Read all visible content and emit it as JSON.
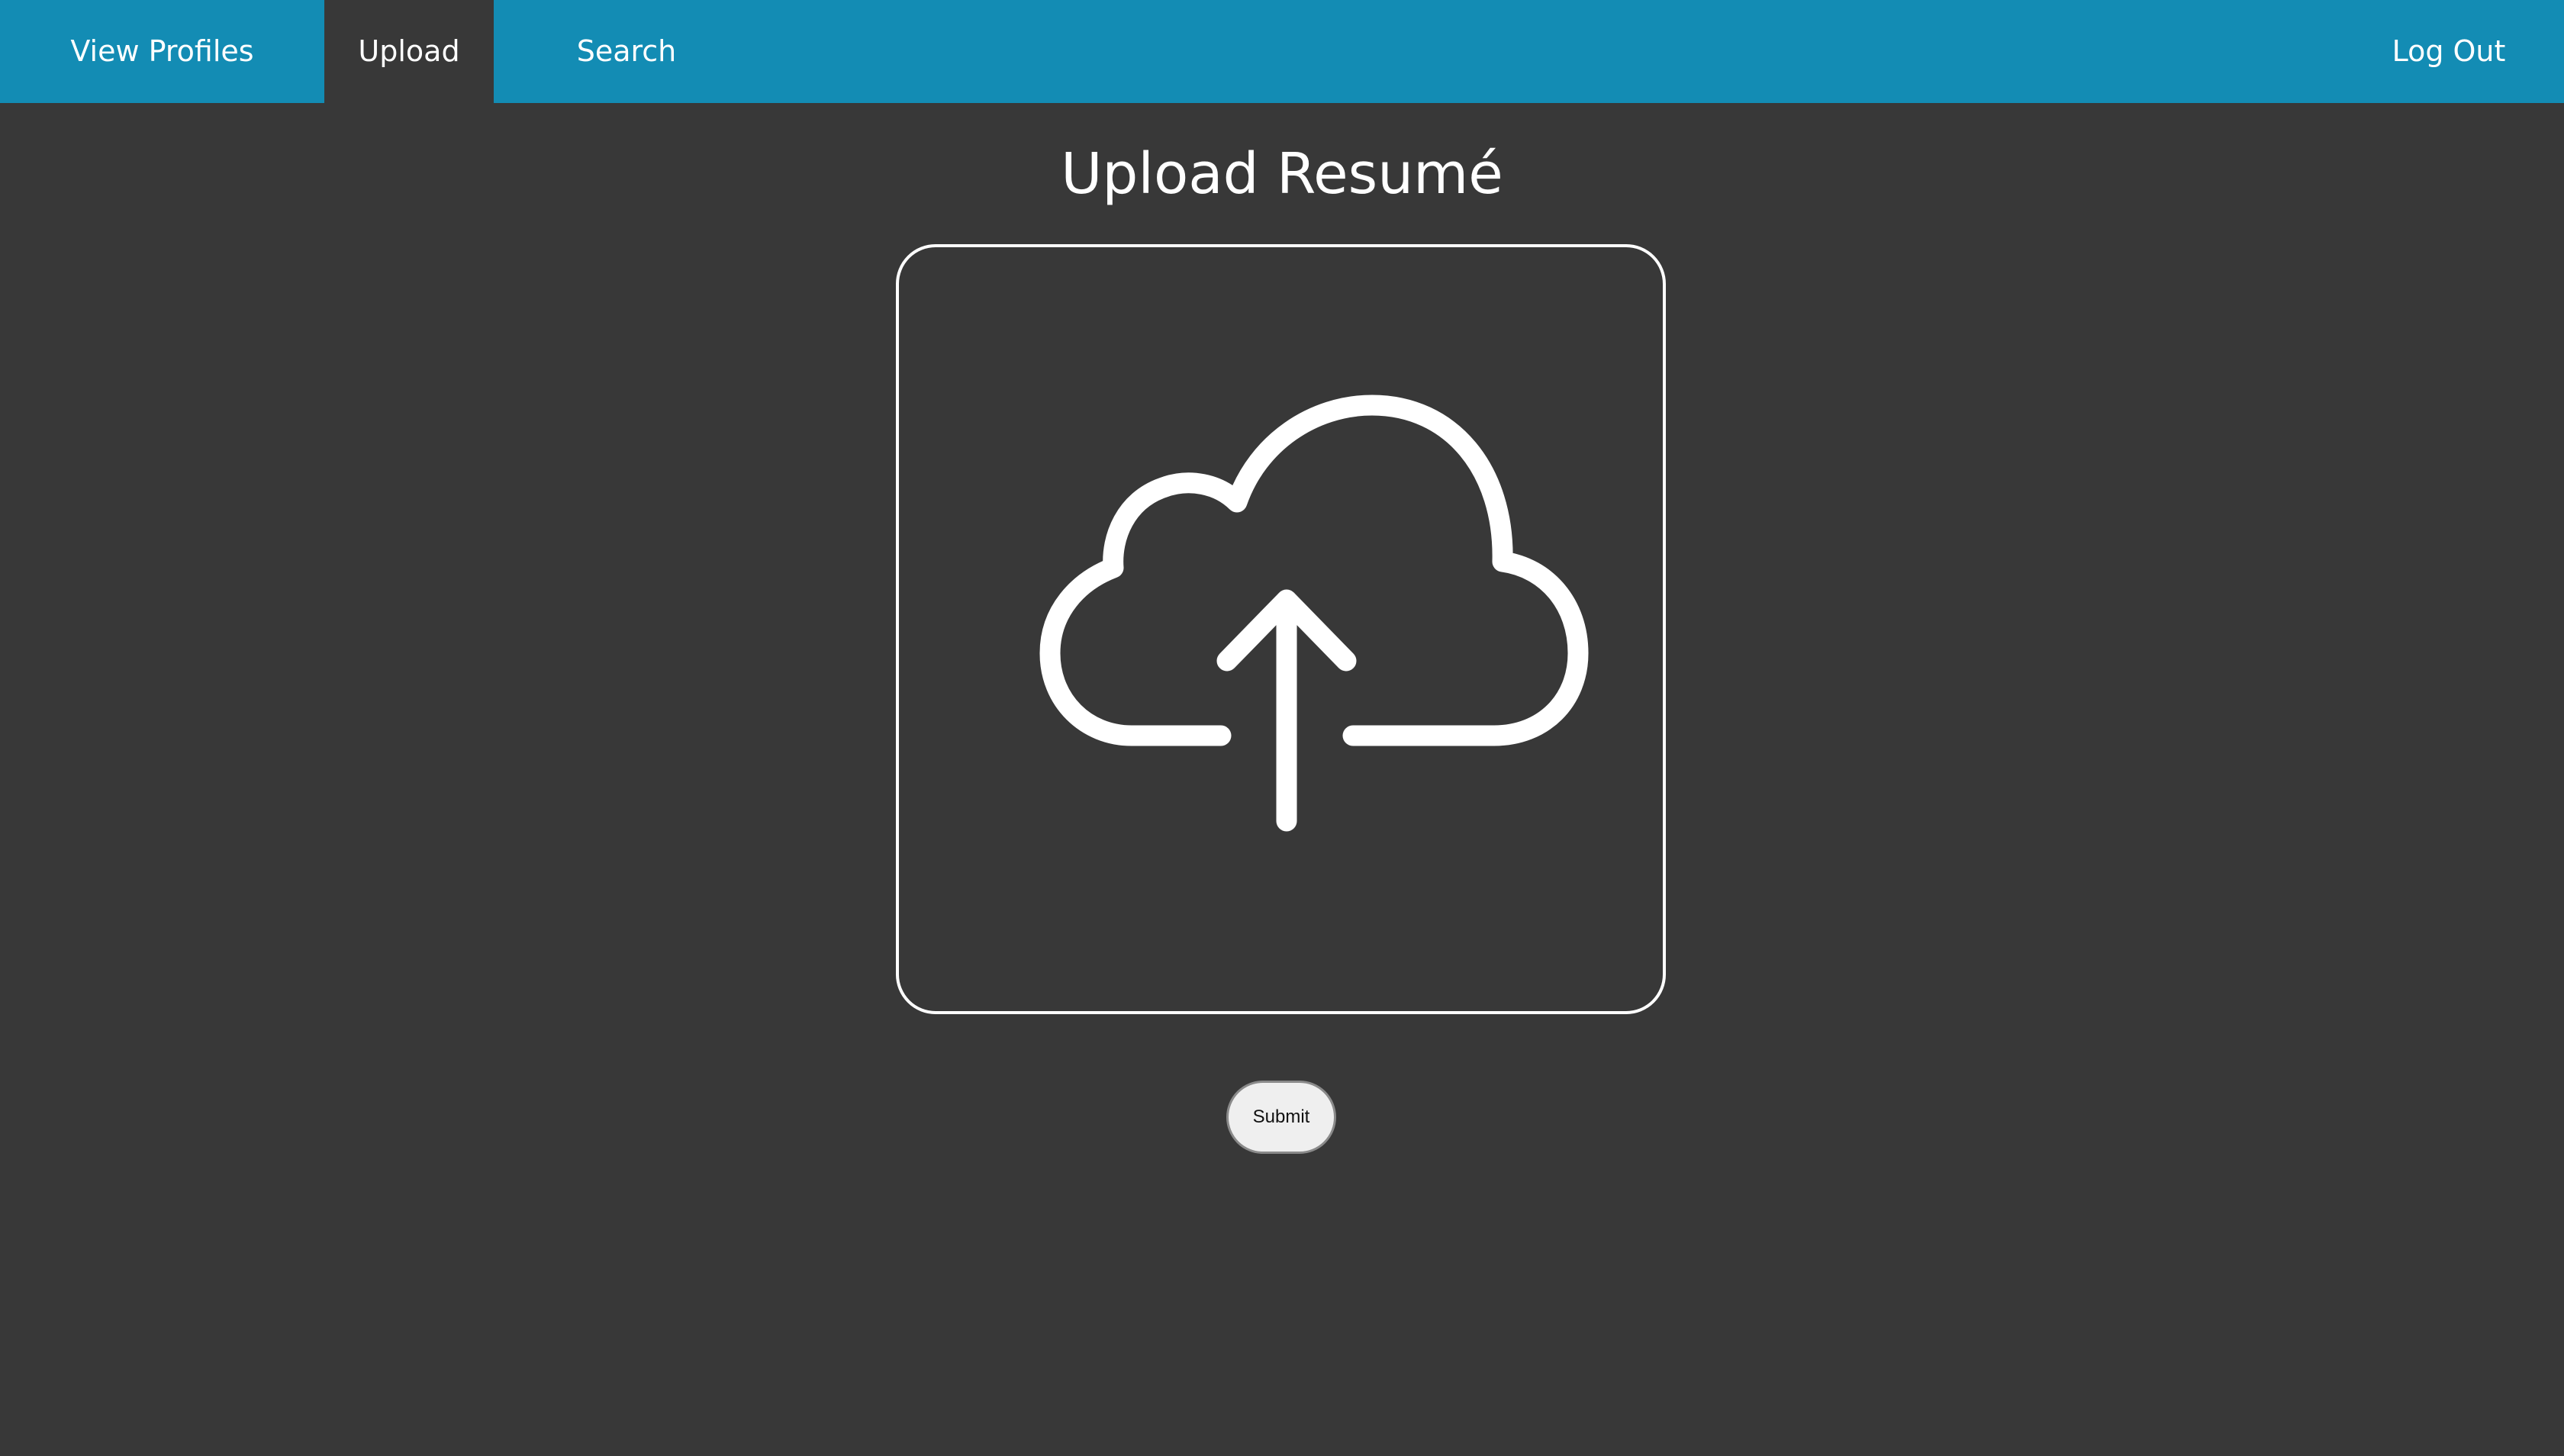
{
  "nav": {
    "items": [
      {
        "label": "View Profiles"
      },
      {
        "label": "Upload"
      },
      {
        "label": "Search"
      }
    ],
    "logout_label": "Log Out"
  },
  "main": {
    "title": "Upload Resumé",
    "dropzone": {
      "icon": "cloud-upload-icon"
    },
    "submit_label": "Submit"
  },
  "colors": {
    "nav_bg": "#138cb4",
    "page_bg": "#383838",
    "text": "#ffffff",
    "button_bg": "#efefef"
  }
}
